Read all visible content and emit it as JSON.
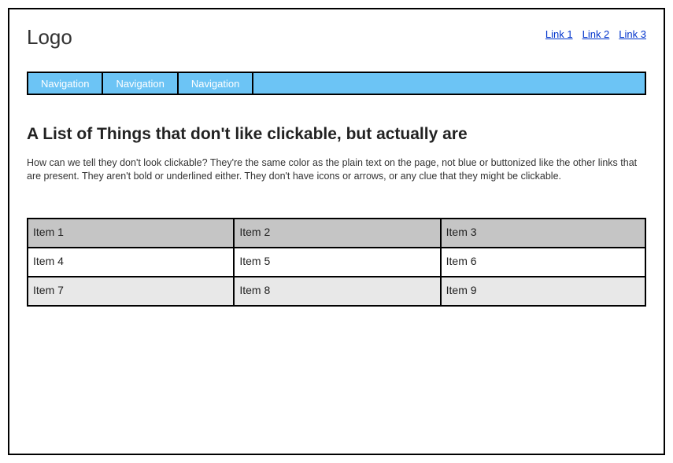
{
  "header": {
    "logo": "Logo",
    "links": [
      "Link 1",
      "Link 2",
      "Link 3"
    ]
  },
  "nav": {
    "items": [
      "Navigation",
      "Navigation",
      "Navigation"
    ]
  },
  "main": {
    "heading": "A List of Things that don't like clickable, but actually are",
    "paragraph": "How can we tell they don't look clickable? They're the same color as the plain text on the page, not blue or buttonized like the other links that are present. They aren't bold or underlined either. They don't have icons or arrows, or any clue that they might be clickable."
  },
  "grid": {
    "rows": [
      [
        "Item 1",
        "Item 2",
        "Item 3"
      ],
      [
        "Item 4",
        "Item 5",
        "Item 6"
      ],
      [
        "Item 7",
        "Item 8",
        "Item 9"
      ]
    ]
  }
}
